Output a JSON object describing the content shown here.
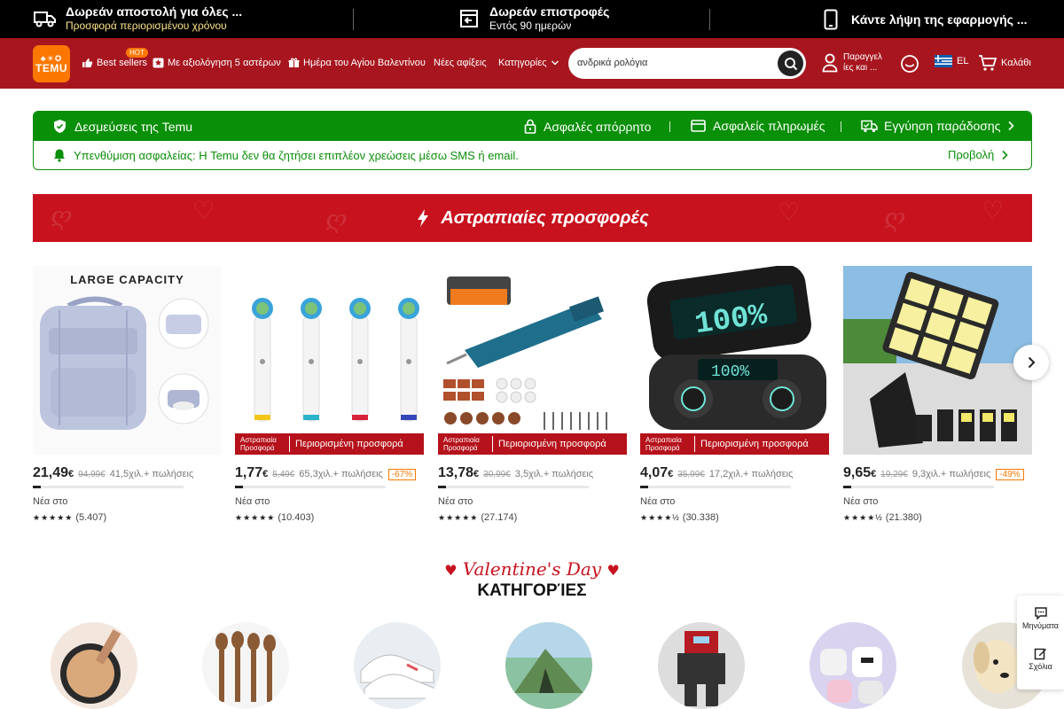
{
  "promo": {
    "shipping_title": "Δωρεάν αποστολή για όλες ...",
    "shipping_sub": "Προσφορά περιορισμένου χρόνου",
    "returns_title": "Δωρεάν επιστροφές",
    "returns_sub": "Εντός 90 ημερών",
    "app_title": "Κάντε λήψη της εφαρμογής ..."
  },
  "header": {
    "logo_word": "TEMU",
    "logo_icons": "♣☀✪",
    "nav": [
      "Best sellers",
      "Με αξιολόγηση 5 αστέρων",
      "Ημέρα του Αγίου Βαλεντίνου",
      "Νέες αφίξεις",
      "Κατηγορίες"
    ],
    "hot_badge": "HOT",
    "search_value": "ανδρικά ρολόγια",
    "orders_label": "Παραγγελ ίες και ...",
    "language": "EL",
    "cart_label": "Καλάθι"
  },
  "trust": {
    "commitments": "Δεσμεύσεις της Temu",
    "secure_privacy": "Ασφαλές απόρρητο",
    "secure_payments": "Ασφαλείς πληρωμές",
    "delivery_guarantee": "Εγγύηση παράδοσης",
    "reminder": "Υπενθύμιση ασφαλείας: Η Temu δεν θα ζητήσει επιπλέον χρεώσεις μέσω SMS ή email.",
    "view": "Προβολή"
  },
  "flash": {
    "title": "Αστραπιαίες προσφορές",
    "tag_a": "Αστραπιαία Προσφορά",
    "tag_b": "Περιορισμένη προσφορά"
  },
  "products": [
    {
      "image_label": "LARGE CAPACITY",
      "price": "21,49",
      "currency": "€",
      "old_price": "94,99€",
      "sold": "41,5χιλ.+ πωλήσεις",
      "discount": "",
      "progress": 0.05,
      "new_in": "Νέα στο",
      "reviews": "(5.407)",
      "stars": "★★★★★"
    },
    {
      "image_label": "",
      "price": "1,77",
      "currency": "€",
      "old_price": "5,49€",
      "sold": "65,3χιλ.+ πωλήσεις",
      "discount": "-67%",
      "progress": 0.05,
      "new_in": "Νέα στο",
      "reviews": "(10.403)",
      "stars": "★★★★★"
    },
    {
      "image_label": "",
      "price": "13,78",
      "currency": "€",
      "old_price": "30,99€",
      "sold": "3,5χιλ.+ πωλήσεις",
      "discount": "",
      "progress": 0.05,
      "new_in": "Νέα στο",
      "reviews": "(27.174)",
      "stars": "★★★★★"
    },
    {
      "image_label": "",
      "price": "4,07",
      "currency": "€",
      "old_price": "35,99€",
      "sold": "17,2χιλ.+ πωλήσεις",
      "discount": "",
      "progress": 0.05,
      "new_in": "Νέα στο",
      "reviews": "(30.338)",
      "stars": "★★★★½"
    },
    {
      "image_label": "",
      "price": "9,65",
      "currency": "€",
      "old_price": "19,29€",
      "sold": "9,3χιλ.+ πωλήσεις",
      "discount": "-49%",
      "progress": 0.05,
      "new_in": "Νέα στο",
      "reviews": "(21.380)",
      "stars": "★★★★½"
    }
  ],
  "categories_section": {
    "script_title": "Valentine's Day",
    "title": "ΚΑΤΗΓΟΡΊΕΣ"
  },
  "side": {
    "messages": "Μηνύματα",
    "feedback": "Σχόλια"
  },
  "colors": {
    "header_bg": "#a7161f",
    "trust_green": "#0a8f08",
    "flash_red": "#c8121e",
    "brand_orange": "#fb7701"
  }
}
